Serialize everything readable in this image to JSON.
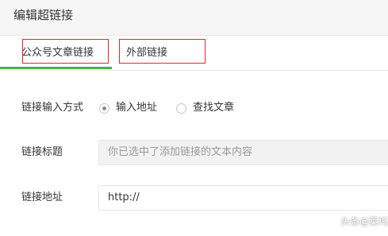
{
  "dialog": {
    "title": "编辑超链接"
  },
  "tabs": [
    {
      "label": "公众号文章链接",
      "active": true
    },
    {
      "label": "外部链接",
      "active": false
    }
  ],
  "form": {
    "mode_label": "链接输入方式",
    "mode_options": [
      {
        "label": "输入地址",
        "checked": true
      },
      {
        "label": "查找文章",
        "checked": false
      }
    ],
    "title_label": "链接标题",
    "title_value": "你已选中了添加链接的文本内容",
    "url_label": "链接地址",
    "url_value": "http://"
  },
  "watermark": {
    "text": "头条@莱坞"
  },
  "colors": {
    "accent": "#44b549",
    "highlight_box": "#e0282e",
    "header_bg": "#f6f6f6"
  }
}
